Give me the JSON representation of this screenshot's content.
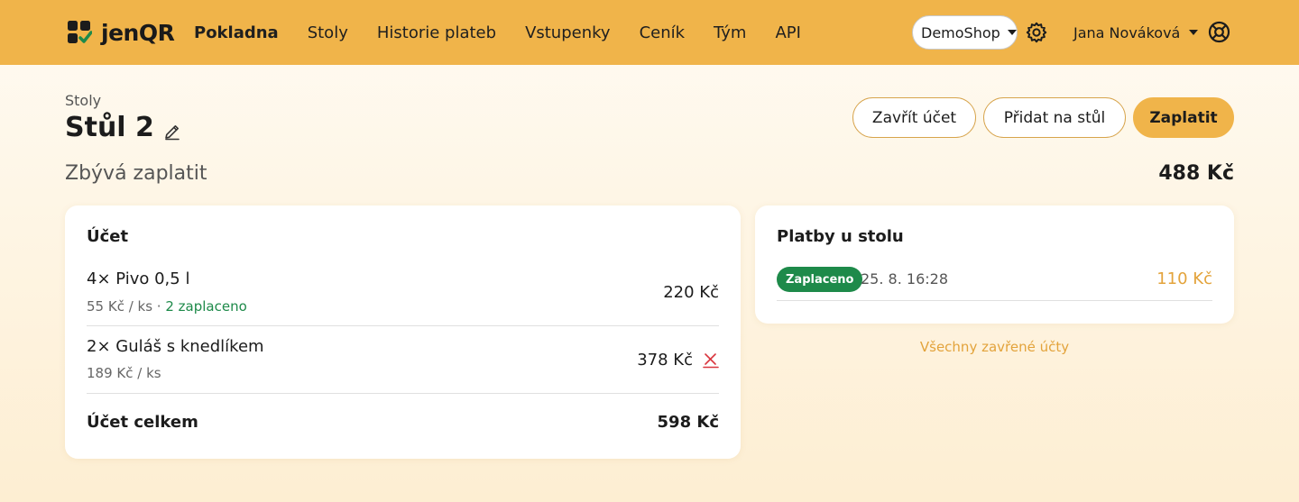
{
  "navbar": {
    "brand": "jenQR",
    "links": [
      "Pokladna",
      "Stoly",
      "Historie plateb",
      "Vstupenky",
      "Ceník",
      "Tým",
      "API"
    ],
    "shop": "DemoShop",
    "user": "Jana Nováková",
    "accent_color": "#f0b44a"
  },
  "header": {
    "breadcrumb": "Stoly",
    "title": "Stůl 2",
    "buttons": {
      "close": "Zavřít účet",
      "add": "Přidat na stůl",
      "pay": "Zaplatit"
    },
    "remaining_label": "Zbývá zaplatit",
    "remaining_value": "488 Kč"
  },
  "bill": {
    "title": "Účet",
    "items": [
      {
        "name": "4× Pivo 0,5 l",
        "unit": "55 Kč / ks",
        "sep": " · ",
        "paid": "2 zaplaceno",
        "price": "220 Kč"
      },
      {
        "name": "2× Guláš s knedlíkem",
        "unit": "189 Kč / ks",
        "price": "378 Kč"
      }
    ],
    "total_label": "Účet celkem",
    "total_value": "598 Kč",
    "paid_color": "#1e8a4a",
    "remove_color": "#d9363e"
  },
  "payments": {
    "title": "Platby u stolu",
    "rows": [
      {
        "status": "Zaplaceno",
        "time": "25. 8. 16:28",
        "amount": "110 Kč"
      }
    ],
    "closed_link": "Všechny zavřené účty",
    "amount_color": "#e3a33b"
  },
  "icons": {
    "logo": "brand-logo-icon",
    "settings": "gear-icon",
    "help": "lifebuoy-icon",
    "edit": "pencil-icon",
    "remove": "close-icon"
  }
}
